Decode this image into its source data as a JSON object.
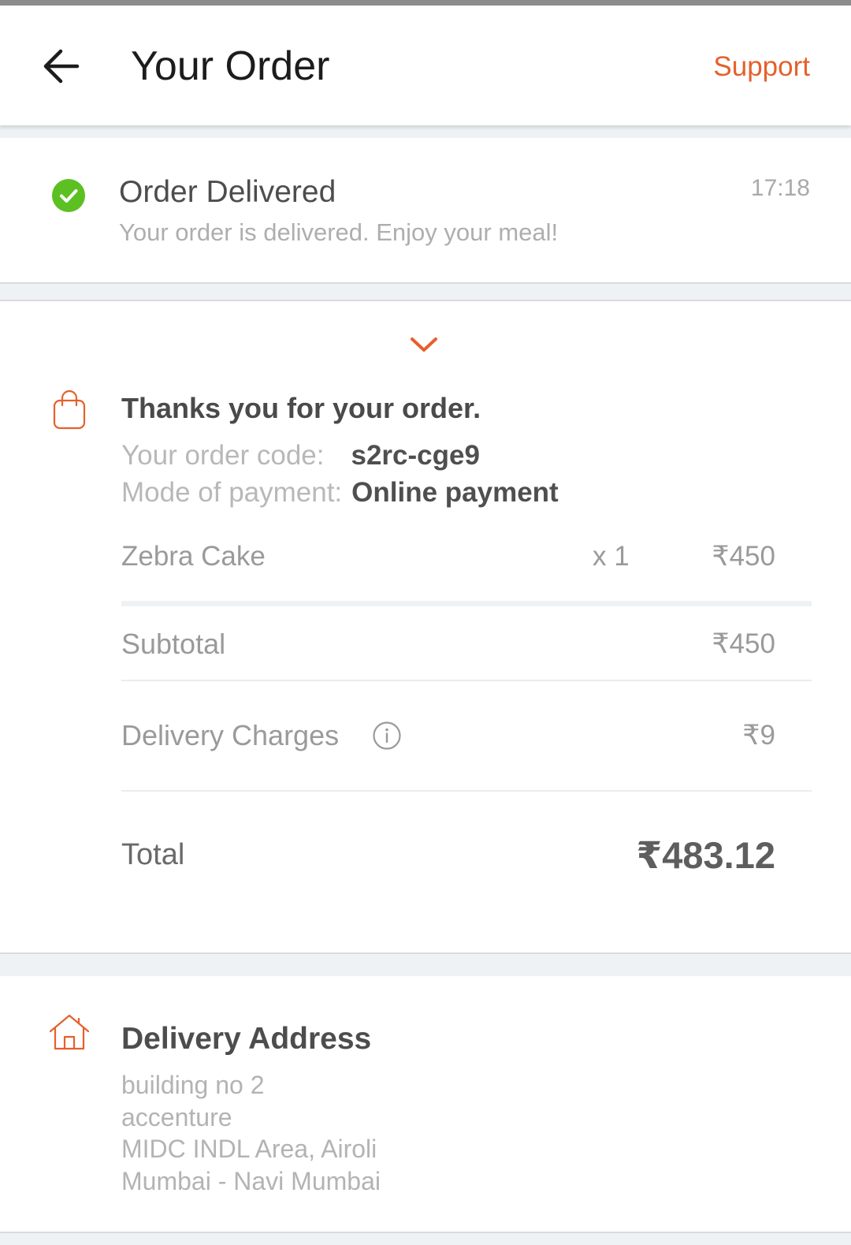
{
  "header": {
    "title": "Your Order",
    "support_label": "Support",
    "back_icon": "arrow-left-icon"
  },
  "status": {
    "icon": "check-circle-icon",
    "title": "Order Delivered",
    "subtitle": "Your order is delivered. Enjoy your meal!",
    "time": "17:18"
  },
  "order": {
    "collapse_icon": "chevron-down-icon",
    "bag_icon": "shopping-bag-icon",
    "heading": "Thanks you for your order.",
    "code_label": "Your order code:",
    "code_value": "s2rc-cge9",
    "payment_label": "Mode of payment:",
    "payment_value": "Online payment",
    "items": [
      {
        "name": "Zebra Cake",
        "qty": "x 1",
        "price": "₹450"
      }
    ],
    "subtotal_label": "Subtotal",
    "subtotal_value": "₹450",
    "delivery_label": "Delivery Charges",
    "delivery_value": "₹9",
    "total_label": "Total",
    "total_value": "₹483.12"
  },
  "address": {
    "icon": "home-icon",
    "title": "Delivery Address",
    "lines": [
      "building no 2",
      "accenture",
      "MIDC INDL Area, Airoli",
      "Mumbai - Navi Mumbai"
    ]
  },
  "colors": {
    "accent": "#e4612c",
    "success": "#5cc022"
  }
}
